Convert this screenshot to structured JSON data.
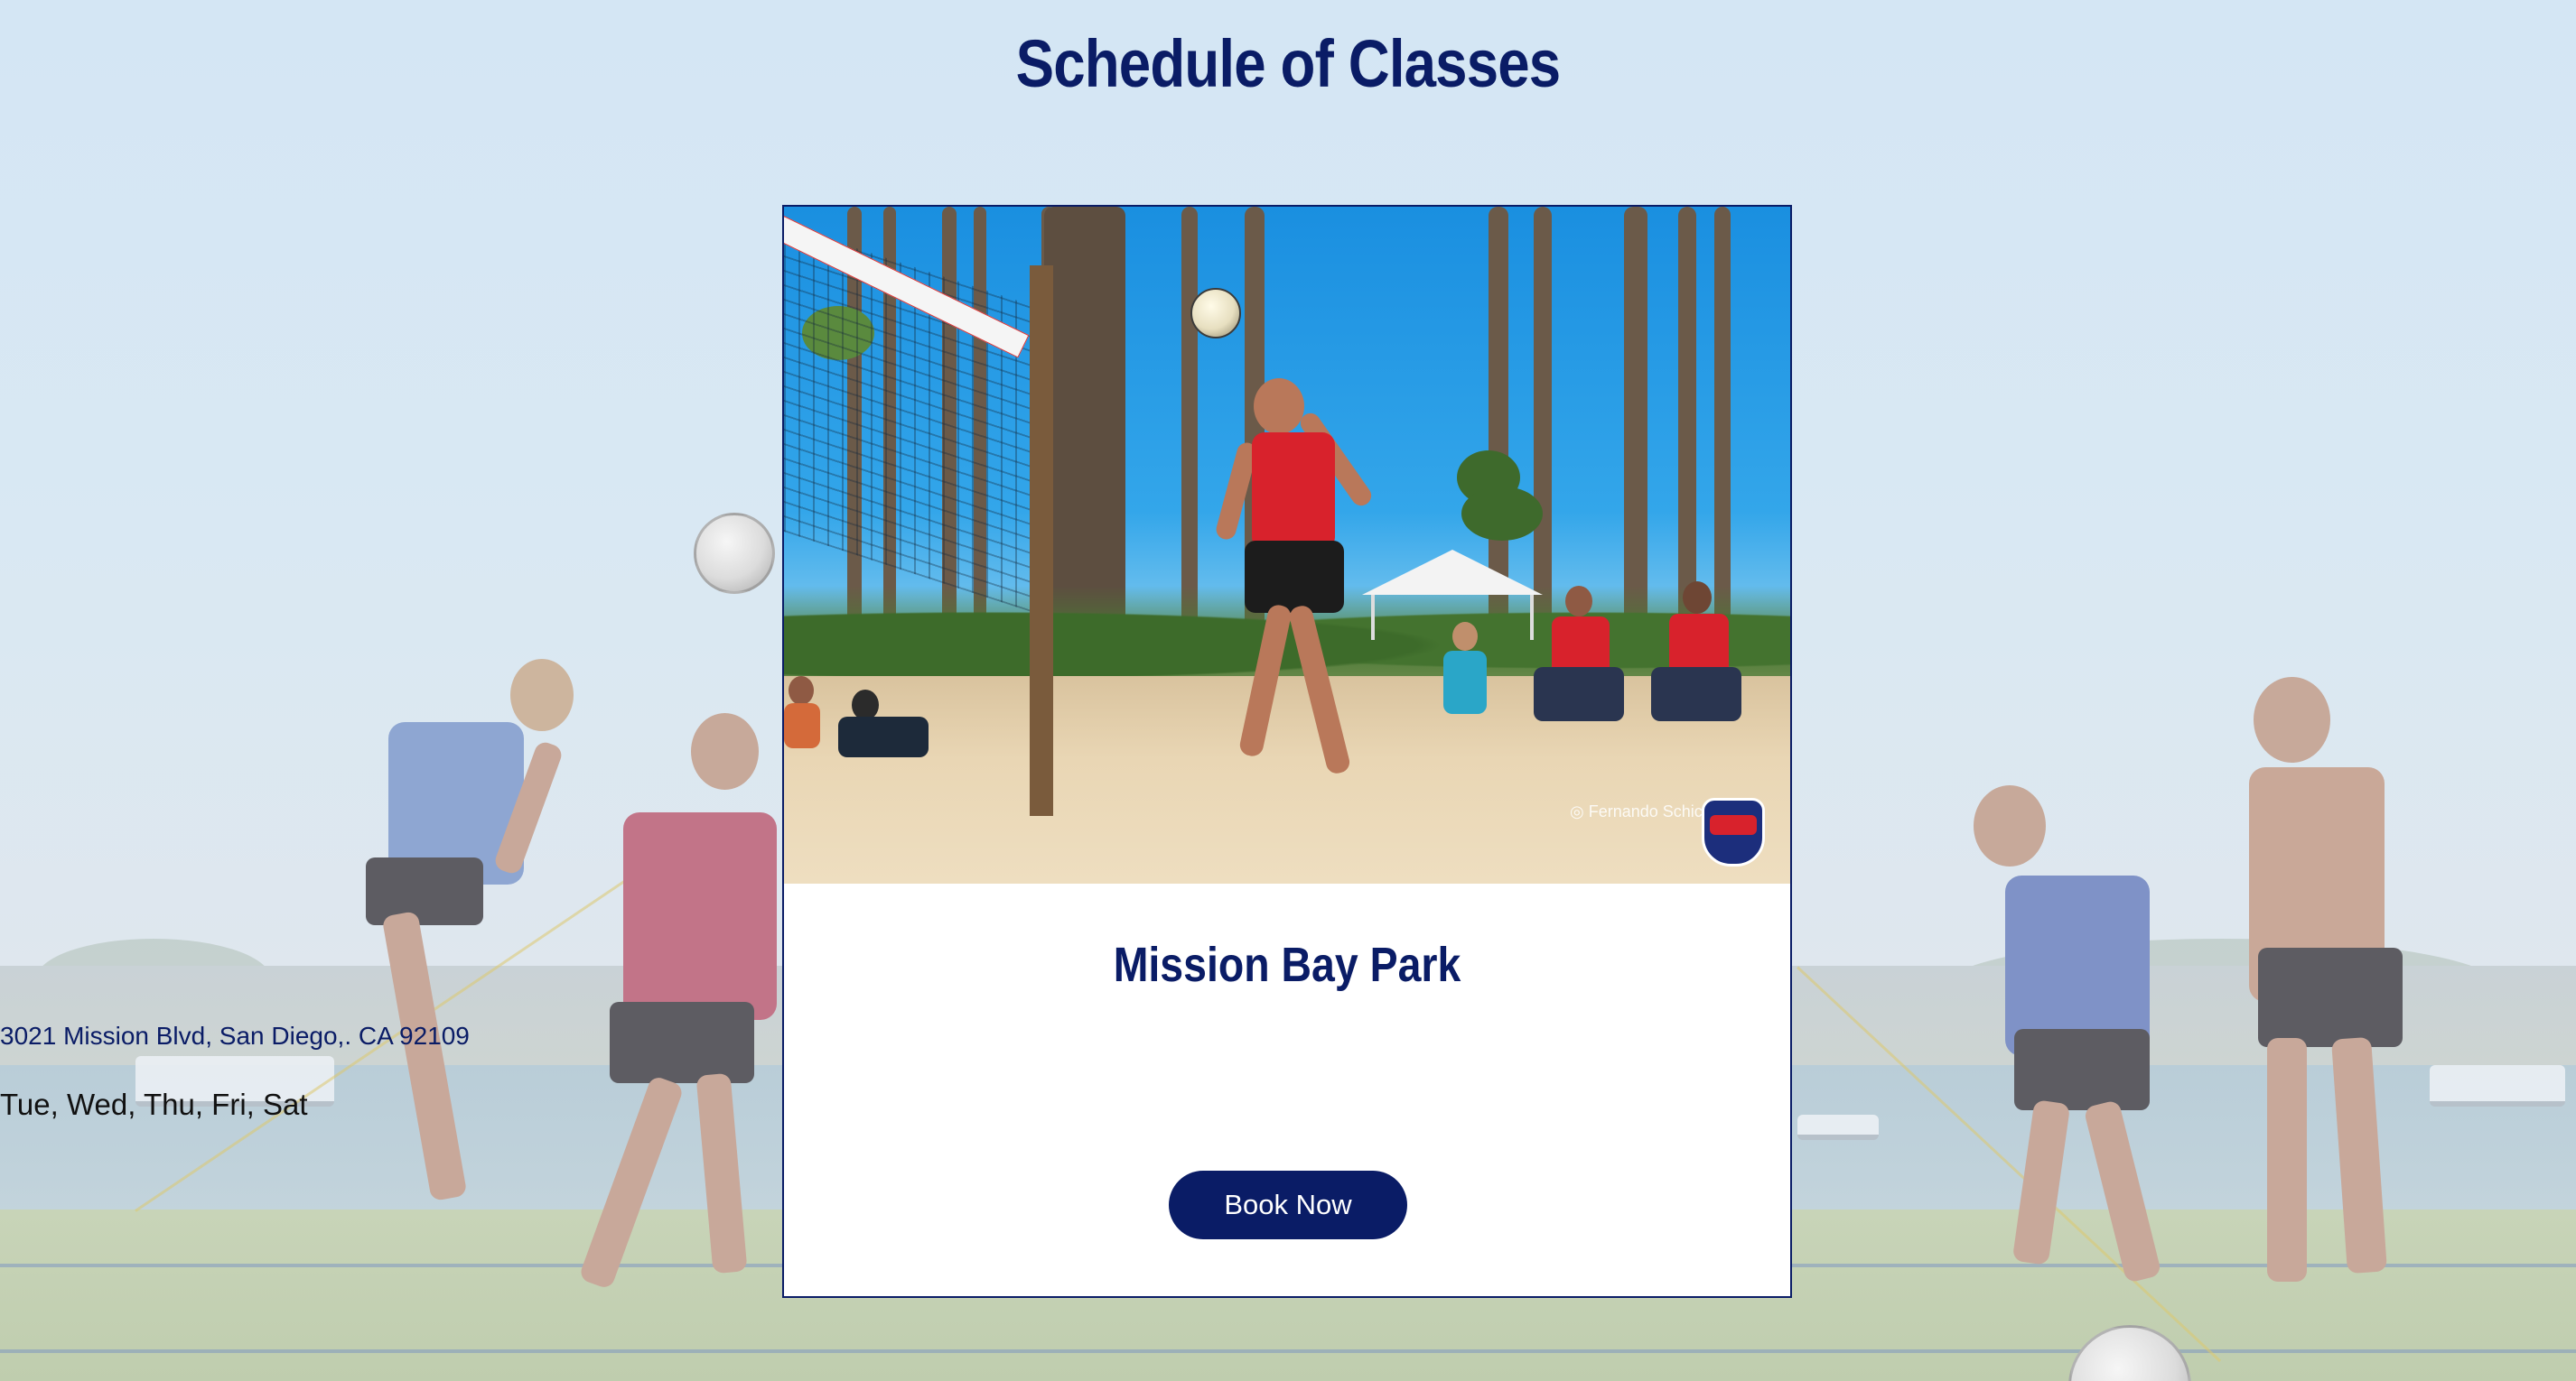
{
  "page": {
    "title": "Schedule of Classes"
  },
  "colors": {
    "brand": "#0a1c66",
    "button_text": "#ffffff",
    "card_background": "#ffffff"
  },
  "locations": [
    {
      "name": "Mission Bay Park",
      "address": "3021 Mission Blvd, San Diego,. CA 92109",
      "days": "Tue, Wed, Thu, Fri, Sat",
      "button_label": "Book Now",
      "photo": "footvolley-beach-photo",
      "photo_credit_logo": "footvolley-club-logo"
    }
  ]
}
